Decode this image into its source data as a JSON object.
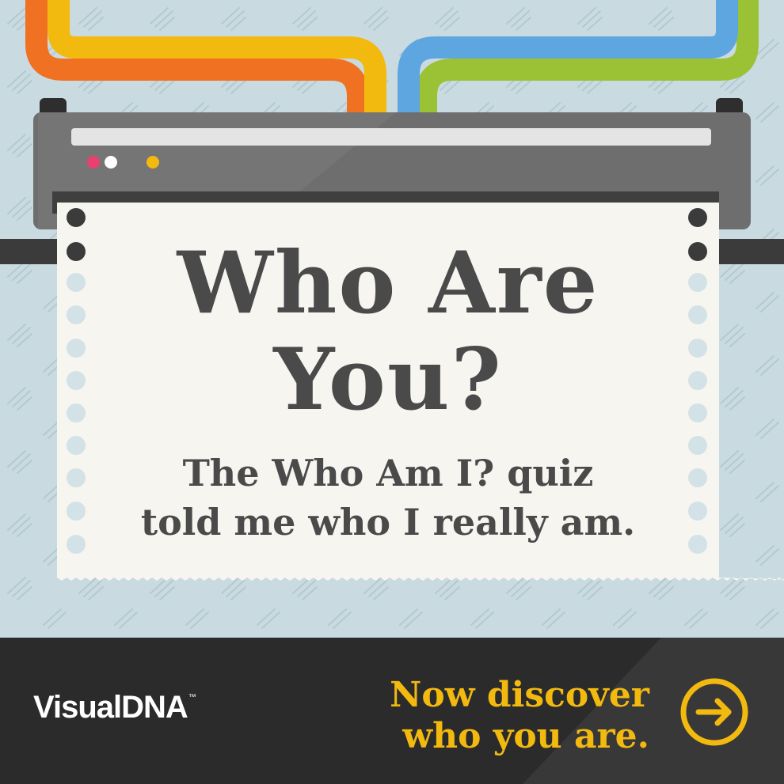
{
  "headline": {
    "line1": "Who Are",
    "line2": "You?"
  },
  "subtext": {
    "line1": "The Who Am I? quiz",
    "line2": "told me who I really am."
  },
  "footer": {
    "logo": "VisualDNA",
    "logo_mark": "™",
    "cta_line1": "Now discover",
    "cta_line2": "who you are.",
    "cta_icon": "arrow-right-circle-icon"
  },
  "colors": {
    "background": "#c9dbe1",
    "cable_orange": "#f07122",
    "cable_yellow": "#f2b90f",
    "cable_blue": "#5ea6e0",
    "cable_green": "#9ac234",
    "printer": "#6e6e6e",
    "paper": "#f6f5f0",
    "text": "#4a4a4a",
    "footer": "#2b2b2b",
    "accent": "#f2b90f",
    "light_red": "#e8416f",
    "light_white": "#ffffff",
    "light_yellow": "#f2b90f"
  }
}
